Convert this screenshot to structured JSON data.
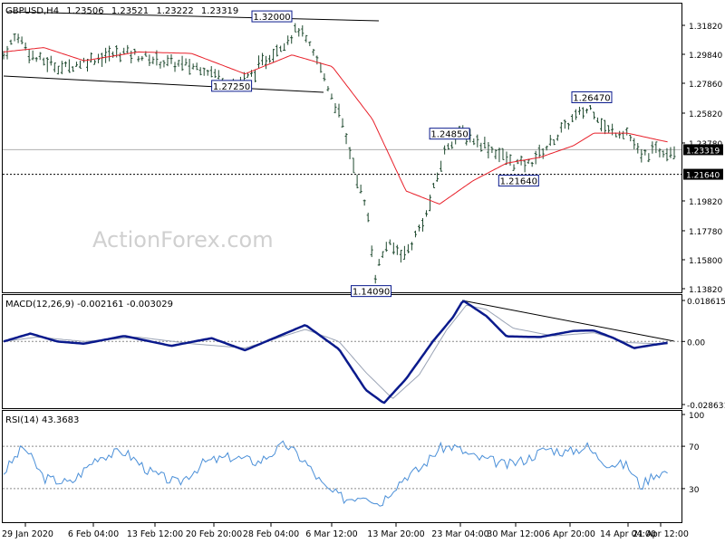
{
  "header": {
    "symbol": "GBPUSD,H4",
    "open": "1.23506",
    "high": "1.23521",
    "low": "1.23222",
    "close": "1.23319"
  },
  "watermark": "ActionForex.com",
  "colors": {
    "price_bars": "#1f4a2f",
    "moving_average": "#e8202a",
    "macd_line": "#0a1a8c",
    "macd_signal": "#9aa3b5",
    "rsi_line": "#4a8fd8",
    "grid_dotted": "#8a8a8a",
    "trendline": "#000000"
  },
  "chart_data": [
    {
      "type": "line",
      "panel": "price",
      "title": "GBPUSD,H4 1.23506 1.23521 1.23222 1.23319",
      "ylim": [
        1.1382,
        1.3318
      ],
      "y_ticks": [
        "1.31820",
        "1.29840",
        "1.27860",
        "1.25820",
        "1.23780",
        "1.21640",
        "1.19820",
        "1.17780",
        "1.15800",
        "1.13820"
      ],
      "x_ticks": [
        "29 Jan 2020",
        "6 Feb 04:00",
        "13 Feb 12:00",
        "20 Feb 20:00",
        "28 Feb 04:00",
        "6 Mar 12:00",
        "13 Mar 20:00",
        "23 Mar 04:00",
        "30 Mar 12:00",
        "6 Apr 20:00",
        "14 Apr 04:00",
        "21 Apr 12:00"
      ],
      "current_price": "1.23319",
      "support_level": "1.21640",
      "annotations": [
        {
          "label": "1.32000",
          "value": 1.32,
          "t": 0.4
        },
        {
          "label": "1.27250",
          "value": 1.2725,
          "t": 0.34
        },
        {
          "label": "1.14090",
          "value": 1.1409,
          "t": 0.548
        },
        {
          "label": "1.24850",
          "value": 1.2485,
          "t": 0.665
        },
        {
          "label": "1.21640",
          "value": 1.2164,
          "t": 0.768
        },
        {
          "label": "1.26470",
          "value": 1.2647,
          "t": 0.877
        }
      ],
      "price_keypoints": [
        [
          0.0,
          1.298
        ],
        [
          0.02,
          1.312
        ],
        [
          0.045,
          1.296
        ],
        [
          0.09,
          1.289
        ],
        [
          0.13,
          1.295
        ],
        [
          0.18,
          1.3
        ],
        [
          0.24,
          1.293
        ],
        [
          0.3,
          1.289
        ],
        [
          0.345,
          1.2773
        ],
        [
          0.37,
          1.2845
        ],
        [
          0.4,
          1.299
        ],
        [
          0.44,
          1.316
        ],
        [
          0.47,
          1.292
        ],
        [
          0.5,
          1.258
        ],
        [
          0.52,
          1.226
        ],
        [
          0.545,
          1.184
        ],
        [
          0.553,
          1.1455
        ],
        [
          0.57,
          1.168
        ],
        [
          0.6,
          1.162
        ],
        [
          0.63,
          1.188
        ],
        [
          0.66,
          1.2355
        ],
        [
          0.68,
          1.245
        ],
        [
          0.72,
          1.236
        ],
        [
          0.76,
          1.224
        ],
        [
          0.78,
          1.2225
        ],
        [
          0.81,
          1.235
        ],
        [
          0.85,
          1.255
        ],
        [
          0.877,
          1.262
        ],
        [
          0.9,
          1.246
        ],
        [
          0.93,
          1.2455
        ],
        [
          0.95,
          1.228
        ],
        [
          0.97,
          1.2325
        ],
        [
          0.99,
          1.2332
        ]
      ],
      "ma_keypoints": [
        [
          0.0,
          1.3
        ],
        [
          0.06,
          1.303
        ],
        [
          0.12,
          1.294
        ],
        [
          0.2,
          1.3
        ],
        [
          0.28,
          1.299
        ],
        [
          0.36,
          1.285
        ],
        [
          0.43,
          1.298
        ],
        [
          0.49,
          1.29
        ],
        [
          0.55,
          1.254
        ],
        [
          0.6,
          1.205
        ],
        [
          0.65,
          1.196
        ],
        [
          0.7,
          1.212
        ],
        [
          0.75,
          1.224
        ],
        [
          0.8,
          1.228
        ],
        [
          0.85,
          1.236
        ],
        [
          0.88,
          1.2445
        ],
        [
          0.93,
          1.2445
        ],
        [
          0.99,
          1.2385
        ]
      ],
      "series": [
        {
          "name": "",
          "values": []
        }
      ]
    },
    {
      "type": "line",
      "panel": "macd",
      "title": "MACD(12,26,9) -0.002161 -0.003029",
      "ylim": [
        -0.028631,
        0.018615
      ],
      "y_ticks": [
        "0.018615",
        "0.00",
        "-0.028631"
      ],
      "macd_keypoints": [
        [
          0.0,
          0.0
        ],
        [
          0.04,
          0.0036
        ],
        [
          0.08,
          0.0
        ],
        [
          0.12,
          -0.001
        ],
        [
          0.18,
          0.0025
        ],
        [
          0.25,
          -0.002
        ],
        [
          0.31,
          0.0015
        ],
        [
          0.36,
          -0.004
        ],
        [
          0.45,
          0.0075
        ],
        [
          0.5,
          -0.0035
        ],
        [
          0.54,
          -0.022
        ],
        [
          0.567,
          -0.028
        ],
        [
          0.6,
          -0.017
        ],
        [
          0.64,
          0.0
        ],
        [
          0.67,
          0.011
        ],
        [
          0.685,
          0.0186
        ],
        [
          0.72,
          0.0115
        ],
        [
          0.75,
          0.0023
        ],
        [
          0.8,
          0.002
        ],
        [
          0.85,
          0.0048
        ],
        [
          0.88,
          0.005
        ],
        [
          0.91,
          0.0015
        ],
        [
          0.94,
          -0.003
        ],
        [
          0.97,
          -0.0015
        ],
        [
          0.99,
          -0.0006
        ]
      ],
      "signal_keypoints": [
        [
          0.0,
          0.0
        ],
        [
          0.05,
          0.002
        ],
        [
          0.12,
          0.0
        ],
        [
          0.2,
          0.002
        ],
        [
          0.28,
          -0.001
        ],
        [
          0.36,
          -0.003
        ],
        [
          0.45,
          0.0055
        ],
        [
          0.5,
          0.0
        ],
        [
          0.54,
          -0.014
        ],
        [
          0.58,
          -0.026
        ],
        [
          0.62,
          -0.015
        ],
        [
          0.66,
          0.005
        ],
        [
          0.69,
          0.0165
        ],
        [
          0.72,
          0.0145
        ],
        [
          0.76,
          0.006
        ],
        [
          0.82,
          0.0025
        ],
        [
          0.88,
          0.004
        ],
        [
          0.93,
          -0.0005
        ],
        [
          0.99,
          -0.0012
        ]
      ]
    },
    {
      "type": "line",
      "panel": "rsi",
      "title": "RSI(14) 43.3683",
      "ylim": [
        0,
        100
      ],
      "y_ticks": [
        "100",
        "70",
        "30",
        "0"
      ],
      "rsi_keypoints": [
        [
          0.0,
          45
        ],
        [
          0.03,
          70
        ],
        [
          0.06,
          40
        ],
        [
          0.1,
          35
        ],
        [
          0.14,
          60
        ],
        [
          0.18,
          65
        ],
        [
          0.22,
          45
        ],
        [
          0.26,
          35
        ],
        [
          0.3,
          55
        ],
        [
          0.34,
          60
        ],
        [
          0.38,
          55
        ],
        [
          0.42,
          72
        ],
        [
          0.45,
          55
        ],
        [
          0.48,
          30
        ],
        [
          0.51,
          20
        ],
        [
          0.54,
          25
        ],
        [
          0.56,
          15
        ],
        [
          0.58,
          30
        ],
        [
          0.6,
          42
        ],
        [
          0.62,
          48
        ],
        [
          0.65,
          68
        ],
        [
          0.67,
          70
        ],
        [
          0.7,
          60
        ],
        [
          0.73,
          56
        ],
        [
          0.75,
          52
        ],
        [
          0.78,
          58
        ],
        [
          0.81,
          68
        ],
        [
          0.84,
          64
        ],
        [
          0.87,
          70
        ],
        [
          0.88,
          63
        ],
        [
          0.9,
          54
        ],
        [
          0.93,
          52
        ],
        [
          0.95,
          32
        ],
        [
          0.97,
          44
        ],
        [
          0.99,
          46
        ]
      ]
    }
  ]
}
